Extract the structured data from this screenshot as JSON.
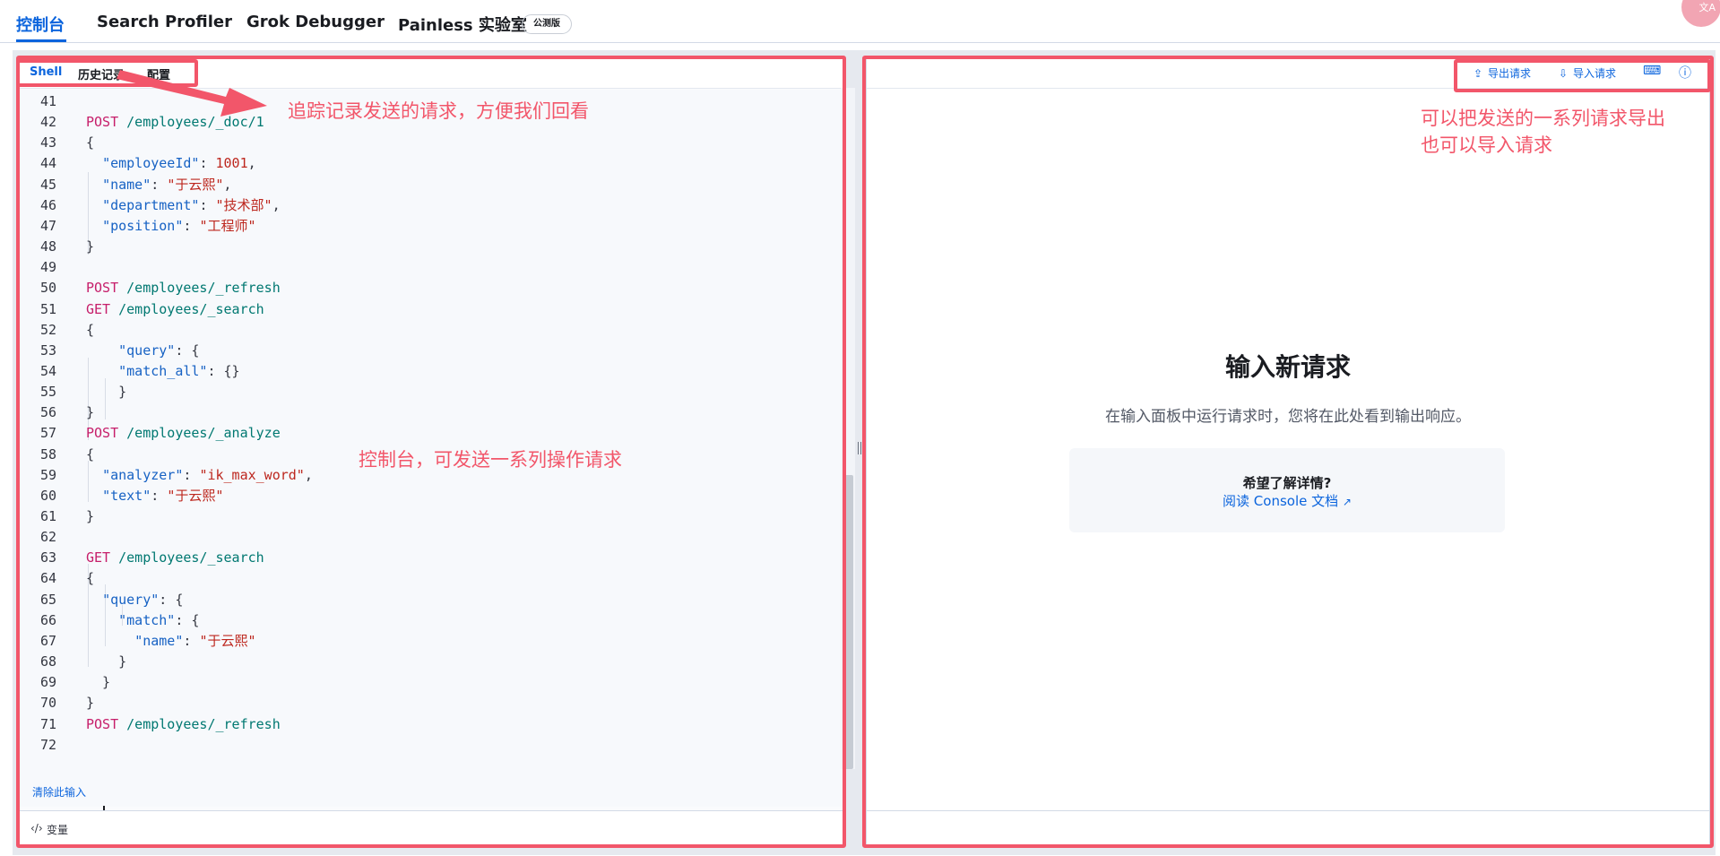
{
  "tabs": [
    {
      "label": "控制台",
      "active": true
    },
    {
      "label": "Search Profiler",
      "active": false
    },
    {
      "label": "Grok Debugger",
      "active": false
    },
    {
      "label": "Painless 实验室",
      "active": false
    }
  ],
  "beta_badge": "公测版",
  "corner_avatar": "文A",
  "left": {
    "subtabs": [
      {
        "label": "Shell",
        "active": true
      },
      {
        "label": "历史记录",
        "active": false
      },
      {
        "label": "配置",
        "active": false
      }
    ],
    "clear_link": "清除此输入",
    "variables_label": "变量"
  },
  "editor": {
    "lines": [
      {
        "n": "41",
        "tokens": []
      },
      {
        "n": "42",
        "tokens": [
          [
            "method",
            "POST"
          ],
          [
            "punct",
            " "
          ],
          [
            "path",
            "/employees/_doc/1"
          ]
        ]
      },
      {
        "n": "43",
        "tokens": [
          [
            "punct",
            "{"
          ]
        ]
      },
      {
        "n": "44",
        "tokens": [
          [
            "punct",
            "  "
          ],
          [
            "key",
            "\"employeeId\""
          ],
          [
            "punct",
            ": "
          ],
          [
            "num",
            "1001"
          ],
          [
            "punct",
            ","
          ]
        ]
      },
      {
        "n": "45",
        "tokens": [
          [
            "punct",
            "  "
          ],
          [
            "key",
            "\"name\""
          ],
          [
            "punct",
            ": "
          ],
          [
            "str",
            "\"于云熙\""
          ],
          [
            "punct",
            ","
          ]
        ]
      },
      {
        "n": "46",
        "tokens": [
          [
            "punct",
            "  "
          ],
          [
            "key",
            "\"department\""
          ],
          [
            "punct",
            ": "
          ],
          [
            "str",
            "\"技术部\""
          ],
          [
            "punct",
            ","
          ]
        ]
      },
      {
        "n": "47",
        "tokens": [
          [
            "punct",
            "  "
          ],
          [
            "key",
            "\"position\""
          ],
          [
            "punct",
            ": "
          ],
          [
            "str",
            "\"工程师\""
          ]
        ]
      },
      {
        "n": "48",
        "tokens": [
          [
            "punct",
            "}"
          ]
        ]
      },
      {
        "n": "49",
        "tokens": []
      },
      {
        "n": "50",
        "tokens": [
          [
            "method",
            "POST"
          ],
          [
            "punct",
            " "
          ],
          [
            "path",
            "/employees/_refresh"
          ]
        ]
      },
      {
        "n": "51",
        "tokens": [
          [
            "method",
            "GET"
          ],
          [
            "punct",
            " "
          ],
          [
            "path",
            "/employees/_search"
          ]
        ]
      },
      {
        "n": "52",
        "tokens": [
          [
            "punct",
            "{"
          ]
        ]
      },
      {
        "n": "53",
        "tokens": [
          [
            "punct",
            "    "
          ],
          [
            "key",
            "\"query\""
          ],
          [
            "punct",
            ": {"
          ]
        ]
      },
      {
        "n": "54",
        "tokens": [
          [
            "punct",
            "    "
          ],
          [
            "key",
            "\"match_all\""
          ],
          [
            "punct",
            ": {}"
          ]
        ]
      },
      {
        "n": "55",
        "tokens": [
          [
            "punct",
            "    }"
          ]
        ]
      },
      {
        "n": "56",
        "tokens": [
          [
            "punct",
            "}"
          ]
        ]
      },
      {
        "n": "57",
        "tokens": [
          [
            "method",
            "POST"
          ],
          [
            "punct",
            " "
          ],
          [
            "path",
            "/employees/_analyze"
          ]
        ]
      },
      {
        "n": "58",
        "tokens": [
          [
            "punct",
            "{"
          ]
        ]
      },
      {
        "n": "59",
        "tokens": [
          [
            "punct",
            "  "
          ],
          [
            "key",
            "\"analyzer\""
          ],
          [
            "punct",
            ": "
          ],
          [
            "str",
            "\"ik_max_word\""
          ],
          [
            "punct",
            ","
          ]
        ]
      },
      {
        "n": "60",
        "tokens": [
          [
            "punct",
            "  "
          ],
          [
            "key",
            "\"text\""
          ],
          [
            "punct",
            ": "
          ],
          [
            "str",
            "\"于云熙\""
          ]
        ]
      },
      {
        "n": "61",
        "tokens": [
          [
            "punct",
            "}"
          ]
        ]
      },
      {
        "n": "62",
        "tokens": []
      },
      {
        "n": "63",
        "tokens": [
          [
            "method",
            "GET"
          ],
          [
            "punct",
            " "
          ],
          [
            "path",
            "/employees/_search"
          ]
        ]
      },
      {
        "n": "64",
        "tokens": [
          [
            "punct",
            "{"
          ]
        ]
      },
      {
        "n": "65",
        "tokens": [
          [
            "punct",
            "  "
          ],
          [
            "key",
            "\"query\""
          ],
          [
            "punct",
            ": {"
          ]
        ]
      },
      {
        "n": "66",
        "tokens": [
          [
            "punct",
            "    "
          ],
          [
            "key",
            "\"match\""
          ],
          [
            "punct",
            ": {"
          ]
        ]
      },
      {
        "n": "67",
        "tokens": [
          [
            "punct",
            "      "
          ],
          [
            "key",
            "\"name\""
          ],
          [
            "punct",
            ": "
          ],
          [
            "str",
            "\"于云熙\""
          ]
        ]
      },
      {
        "n": "68",
        "tokens": [
          [
            "punct",
            "    }"
          ]
        ]
      },
      {
        "n": "69",
        "tokens": [
          [
            "punct",
            "  }"
          ]
        ]
      },
      {
        "n": "70",
        "tokens": [
          [
            "punct",
            "}"
          ]
        ]
      },
      {
        "n": "71",
        "tokens": [
          [
            "method",
            "POST"
          ],
          [
            "punct",
            " "
          ],
          [
            "path",
            "/employees/_refresh"
          ]
        ]
      },
      {
        "n": "72",
        "tokens": []
      }
    ]
  },
  "right": {
    "export_label": "导出请求",
    "import_label": "导入请求",
    "empty_title": "输入新请求",
    "empty_subtitle": "在输入面板中运行请求时，您将在此处看到输出响应。",
    "help_title": "希望了解详情?",
    "help_link": "阅读 Console 文档"
  },
  "annotations": {
    "history_note": "追踪记录发送的请求，方便我们回看",
    "console_note": "控制台，可发送一系列操作请求",
    "export_note_line1": "可以把发送的一系列请求导出",
    "export_note_line2": "也可以导入请求",
    "color": "#f2566a"
  },
  "icons": {
    "export": "export-icon",
    "import": "import-icon",
    "keyboard": "keyboard-icon",
    "help": "help-icon",
    "variables": "code-icon",
    "external": "external-link-icon"
  }
}
